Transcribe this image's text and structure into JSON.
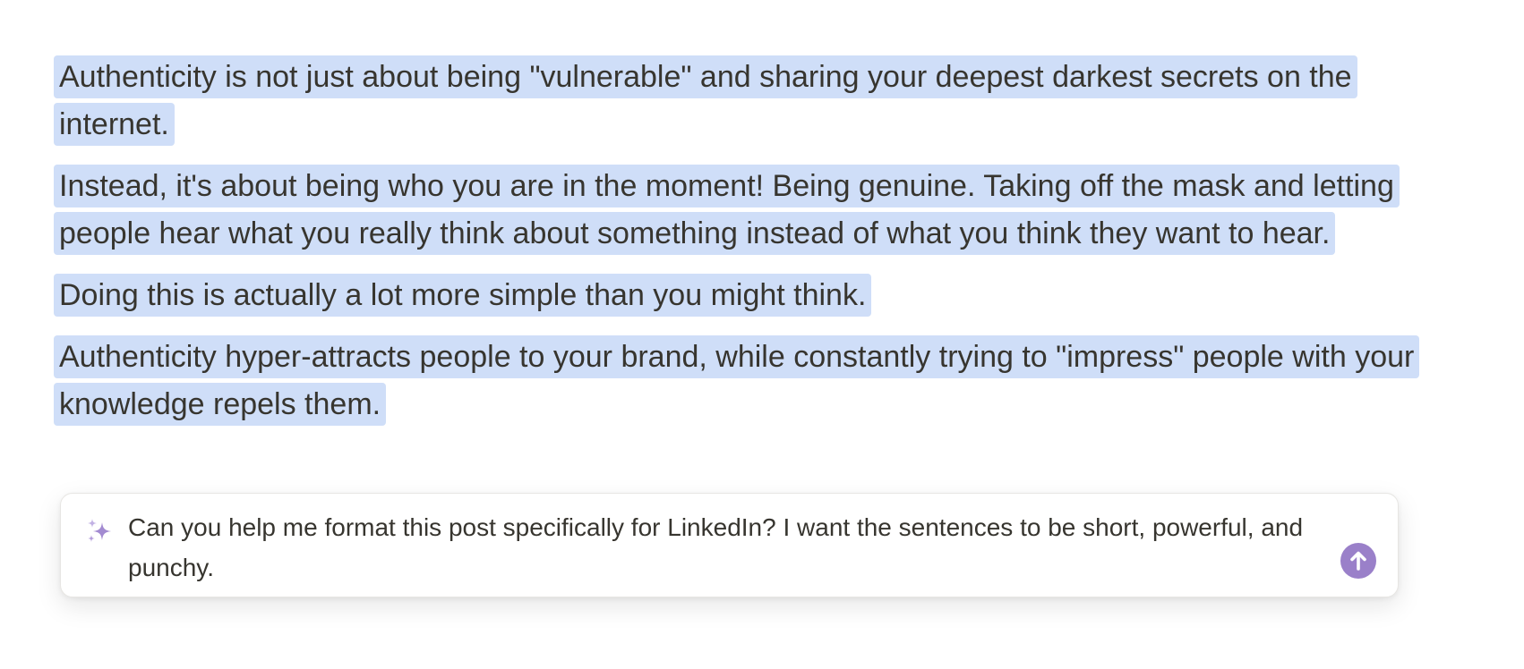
{
  "document": {
    "paragraphs": [
      "Authenticity is not just about being \"vulnerable\" and sharing your deepest darkest secrets on the internet.",
      "Instead, it's about being who you are in the moment! Being genuine. Taking off the mask and letting people hear what you really think about something instead of what you think they want to hear.",
      "Doing this is actually a lot more simple than you might think.",
      "Authenticity hyper-attracts people to your brand, while constantly trying to \"impress\" people with your knowledge repels them."
    ]
  },
  "ai_prompt": {
    "text": "Can you help me format this post specifically for LinkedIn? I want the sentences to be short, powerful, and punchy.",
    "icon": "sparkle-icon",
    "send_icon": "arrow-up-icon"
  },
  "colors": {
    "selection_highlight": "#cfdef8",
    "accent_purple": "#9a80c9",
    "text": "#37352f"
  }
}
